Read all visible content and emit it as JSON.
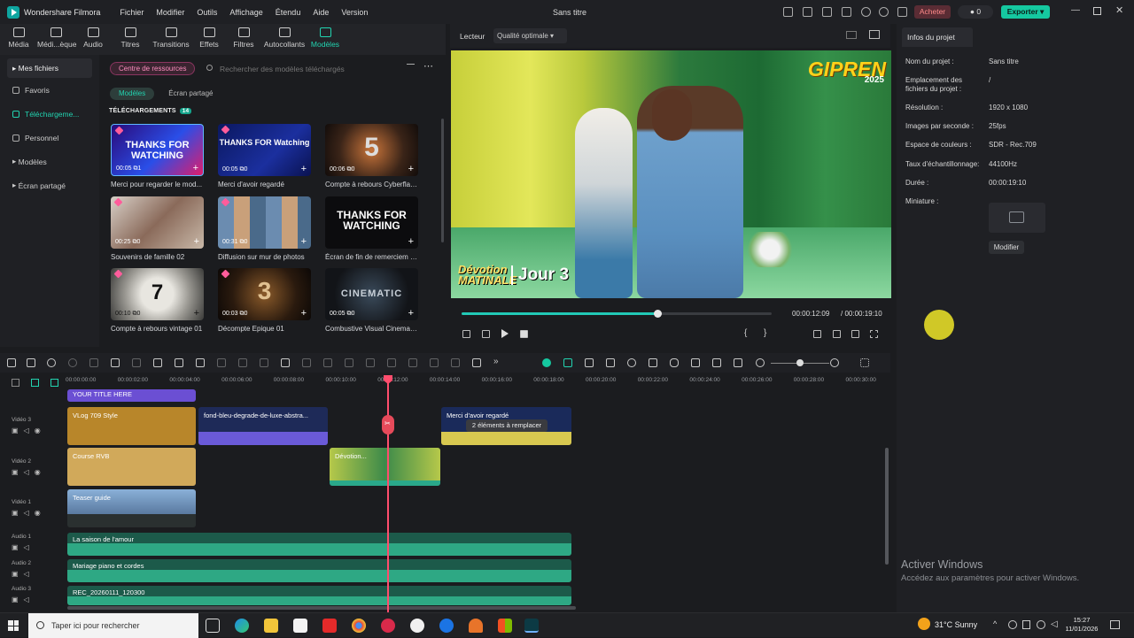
{
  "app": {
    "name": "Wondershare Filmora",
    "window_title": "Sans titre"
  },
  "menu": [
    "Fichier",
    "Modifier",
    "Outils",
    "Affichage",
    "Étendu",
    "Aide",
    "Version"
  ],
  "header": {
    "buy_label": "Acheter",
    "credits": "0",
    "export_label": "Exporter"
  },
  "toolbar": [
    {
      "label": "Média",
      "icon": "media-icon"
    },
    {
      "label": "Médi...èque",
      "icon": "library-icon"
    },
    {
      "label": "Audio",
      "icon": "audio-icon"
    },
    {
      "label": "Titres",
      "icon": "titles-icon"
    },
    {
      "label": "Transitions",
      "icon": "transitions-icon"
    },
    {
      "label": "Effets",
      "icon": "effects-icon"
    },
    {
      "label": "Filtres",
      "icon": "filters-icon"
    },
    {
      "label": "Autocollants",
      "icon": "stickers-icon"
    },
    {
      "label": "Modèles",
      "icon": "templates-icon",
      "active": true
    }
  ],
  "sidebar": [
    {
      "label": "Mes fichiers",
      "type": "group"
    },
    {
      "label": "Favoris"
    },
    {
      "label": "Téléchargeme...",
      "selected": true
    },
    {
      "label": "Personnel"
    },
    {
      "label": "Modèles",
      "type": "group"
    },
    {
      "label": "Écran partagé",
      "type": "group"
    }
  ],
  "assets": {
    "resource_center": "Centre de ressources",
    "search_placeholder": "Rechercher des modèles téléchargés",
    "tabs": [
      "Modèles",
      "Écran partagé"
    ],
    "section_label": "TÉLÉCHARGEMENTS",
    "section_count": "14",
    "items": [
      {
        "title": "Merci pour regarder le mod...",
        "duration": "00:05",
        "count": "1",
        "big": "THANKS FOR WATCHING"
      },
      {
        "title": "Merci d'avoir regardé",
        "duration": "00:05",
        "count": "0",
        "big": "THANKS FOR Watching"
      },
      {
        "title": "Compte à rebours Cyberflame",
        "duration": "00:06",
        "count": "0",
        "big": "5"
      },
      {
        "title": "Souvenirs de famille 02",
        "duration": "00:25",
        "count": "0",
        "big": ""
      },
      {
        "title": "Diffusion sur mur de photos",
        "duration": "00:31",
        "count": "0",
        "big": ""
      },
      {
        "title": "Écran de fin de remerciem e...",
        "duration": "",
        "count": "",
        "big": "THANKS FOR WATCHING"
      },
      {
        "title": "Compte à rebours vintage 01",
        "duration": "00:10",
        "count": "0",
        "big": "7"
      },
      {
        "title": "Décompte Epique 01",
        "duration": "00:03",
        "count": "0",
        "big": "3"
      },
      {
        "title": "Combustive Visual Cinemati...",
        "duration": "00:05",
        "count": "0",
        "big": "CINEMATIC"
      }
    ]
  },
  "preview": {
    "label": "Lecteur",
    "quality": "Qualité optimale",
    "watermark": "GIPREN",
    "watermark_year": "2025",
    "caption_left": "Dévotion MATINALE",
    "caption_right": "Jour 3",
    "progress": 0.63,
    "current_time": "00:00:12:09",
    "total_time": "/  00:00:19:10"
  },
  "project_info": {
    "tab": "Infos du projet",
    "rows": [
      {
        "label": "Nom du projet :",
        "value": "Sans titre"
      },
      {
        "label": "Emplacement des fichiers du projet :",
        "value": "/"
      },
      {
        "label": "Résolution :",
        "value": "1920 x 1080"
      },
      {
        "label": "Images par seconde :",
        "value": "25fps"
      },
      {
        "label": "Espace de couleurs :",
        "value": "SDR - Rec.709"
      },
      {
        "label": "Taux d'échantillonnage:",
        "value": "44100Hz"
      },
      {
        "label": "Durée :",
        "value": "00:00:19:10"
      },
      {
        "label": "Miniature :",
        "value": ""
      }
    ],
    "modify_label": "Modifier"
  },
  "activation": {
    "title": "Activer Windows",
    "subtitle": "Accédez aux paramètres pour activer Windows."
  },
  "timeline": {
    "ruler": [
      "00:00:00:00",
      "00:00:02:00",
      "00:00:04:00",
      "00:00:06:00",
      "00:00:08:00",
      "00:00:10:00",
      "00:00:12:00",
      "00:00:14:00",
      "00:00:16:00",
      "00:00:18:00",
      "00:00:20:00",
      "00:00:22:00",
      "00:00:24:00",
      "00:00:26:00",
      "00:00:28:00",
      "00:00:30:00"
    ],
    "tracks": [
      "Vidéo 3",
      "Vidéo 2",
      "Vidéo 1",
      "Audio 1",
      "Audio 2",
      "Audio 3"
    ],
    "clips": {
      "top_title": "YOUR TITLE HERE",
      "vlog": "VLog 709 Style",
      "fond": "fond-bleu-degrade-de-luxe-abstra...",
      "merci": "Merci d'avoir regardé",
      "course": "Course RVB",
      "mid": "Dévotion...",
      "ident": "Teaser guide",
      "audio1": "La saison de l'amour",
      "audio2": "Mariage piano et cordes",
      "audio3": "REC_20260111_120300"
    },
    "tooltip": "2 éléments à remplacer"
  },
  "taskbar": {
    "search_placeholder": "Taper ici pour rechercher",
    "weather": "31°C  Sunny",
    "time": "15:27",
    "date": "11/01/2026"
  },
  "colors": {
    "accent": "#22d3b0",
    "export": "#15c8a0",
    "buy": "#ff8a8a",
    "playhead": "#ff4d6d"
  }
}
